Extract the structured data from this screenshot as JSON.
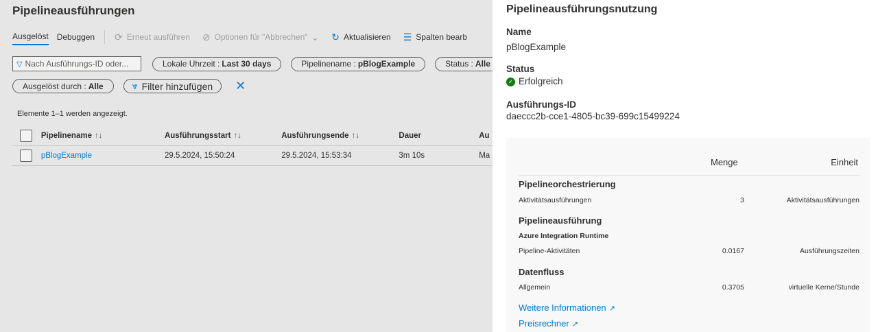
{
  "page": {
    "title": "Pipelineausführungen",
    "tabs": [
      {
        "label": "Ausgelöst"
      },
      {
        "label": "Debuggen"
      }
    ],
    "commands": [
      {
        "label": "Erneut ausführen",
        "icon": "rerun-icon"
      },
      {
        "label": "Optionen für \"Abbrechen\"",
        "icon": "cancel-icon"
      },
      {
        "label": "Aktualisieren",
        "icon": "refresh-icon"
      },
      {
        "label": "Spalten bearb",
        "icon": "columns-icon"
      }
    ],
    "search_placeholder": "Nach Ausführungs-ID oder...",
    "filters": [
      {
        "label": "Lokale Uhrzeit : ",
        "value": "Last 30 days"
      },
      {
        "label": "Pipelinename : ",
        "value": "pBlogExample"
      },
      {
        "label": "Status : ",
        "value": "Alle"
      },
      {
        "label": "Ausgelöst durch : ",
        "value": "Alle"
      }
    ],
    "add_filter_label": "Filter hinzufügen",
    "count_text": "Elemente 1–1 werden angezeigt.",
    "table": {
      "headers": [
        "Pipelinename",
        "Ausführungsstart",
        "Ausführungsende",
        "Dauer",
        "Au"
      ],
      "rows": [
        {
          "name": "pBlogExample",
          "start": "29.5.2024, 15:50:24",
          "end": "29.5.2024, 15:53:34",
          "duration": "3m 10s",
          "trigger": "Ma"
        }
      ]
    }
  },
  "panel": {
    "title": "Pipelineausführungsnutzung",
    "name_label": "Name",
    "name_value": "pBlogExample",
    "status_label": "Status",
    "status_value": "Erfolgreich",
    "id_label": "Ausführungs-ID",
    "id_value": "daeccc2b-cce1-4805-bc39-699c15499224",
    "usage": {
      "headers": {
        "menge": "Menge",
        "einheit": "Einheit"
      },
      "sections": [
        {
          "title": "Pipelineorchestrierung",
          "rows": [
            {
              "name": "Aktivitätsausführungen",
              "qty": "3",
              "unit": "Aktivitätsausführungen"
            }
          ]
        },
        {
          "title": "Pipelineausführung",
          "subtitle": "Azure Integration Runtime",
          "rows": [
            {
              "name": "Pipeline-Aktivitäten",
              "qty": "0.0167",
              "unit": "Ausführungszeiten"
            }
          ]
        },
        {
          "title": "Datenfluss",
          "rows": [
            {
              "name": "Allgemein",
              "qty": "0.3705",
              "unit": "virtuelle Kerne/Stunde"
            }
          ]
        }
      ],
      "links": [
        {
          "label": "Weitere Informationen"
        },
        {
          "label": "Preisrechner"
        }
      ]
    }
  },
  "colors": {
    "accent": "#0078d4",
    "success": "#107c10",
    "dim_background": "#e6e6e6"
  }
}
